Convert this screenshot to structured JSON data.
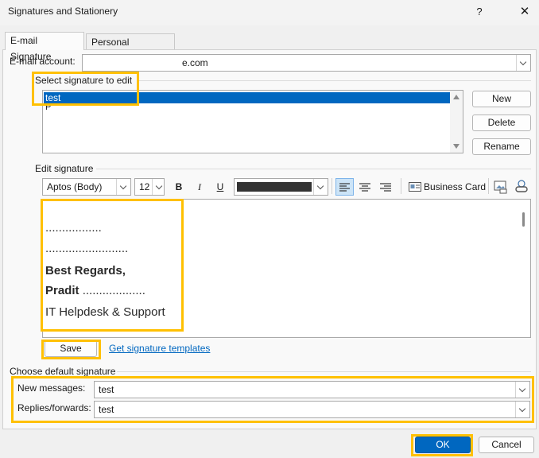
{
  "window": {
    "title": "Signatures and Stationery",
    "help": "?",
    "close": "✕"
  },
  "tabs": [
    {
      "label": "E-mail Signature"
    },
    {
      "label": "Personal Stationery"
    }
  ],
  "email_account": {
    "label": "E-mail account:",
    "value": "e.com"
  },
  "select_signature": {
    "label": "Select signature to edit",
    "items": [
      "test",
      "P"
    ],
    "buttons": {
      "new": "New",
      "delete": "Delete",
      "rename": "Rename"
    }
  },
  "edit_signature": {
    "label": "Edit signature",
    "toolbar": {
      "font": "Aptos (Body)",
      "size": "12",
      "bold": "B",
      "italic": "I",
      "underline": "U",
      "font_color": "#333333",
      "business_card": "Business Card"
    },
    "content": [
      ".................",
      ".........................",
      "Best Regards,",
      "Pradit ...................",
      "IT Helpdesk & Support"
    ],
    "save": "Save",
    "templates_link": "Get signature templates"
  },
  "default_signature": {
    "label": "Choose default signature",
    "new_messages": {
      "label": "New messages:",
      "value": "test"
    },
    "replies": {
      "label": "Replies/forwards:",
      "value": "test"
    }
  },
  "footer": {
    "ok": "OK",
    "cancel": "Cancel"
  },
  "colors": {
    "highlight": "#ffc000",
    "selection": "#0067c0",
    "link": "#0067c0"
  }
}
